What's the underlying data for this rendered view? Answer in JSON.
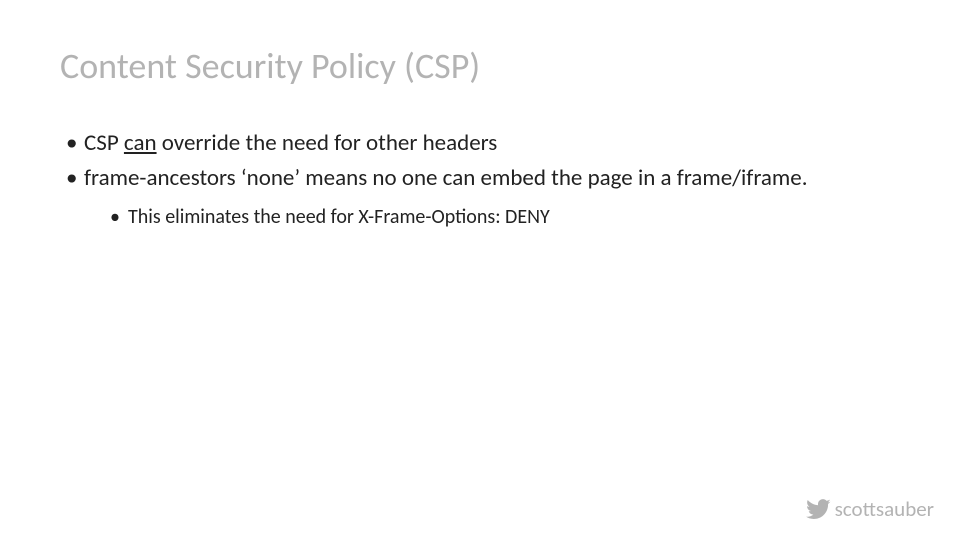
{
  "slide": {
    "title": "Content Security Policy (CSP)",
    "bullets": {
      "b1_pre": "CSP ",
      "b1_can": "can",
      "b1_post": " override the need for other headers",
      "b2": "frame-ancestors ‘none’ means no one can embed the page in a frame/iframe.",
      "b2_sub1": "This eliminates the need for X-Frame-Options: DENY"
    }
  },
  "footer": {
    "handle": "scottsauber"
  }
}
